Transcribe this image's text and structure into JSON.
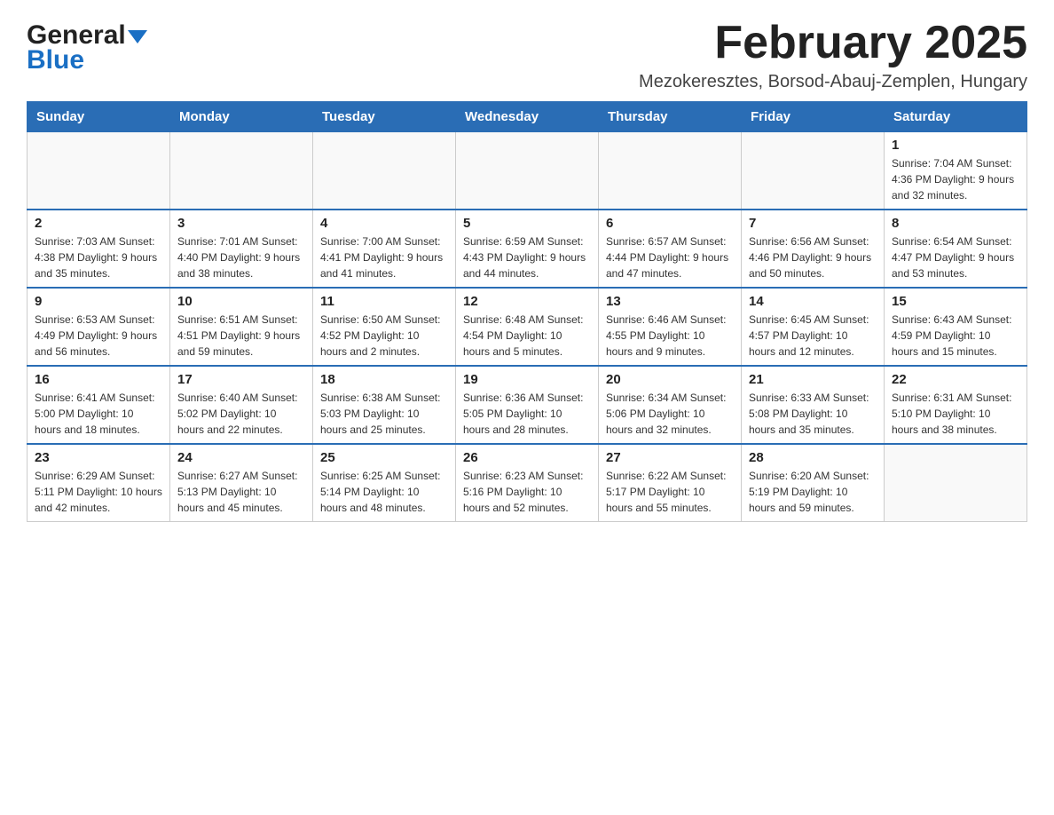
{
  "header": {
    "month_title": "February 2025",
    "location": "Mezokeresztes, Borsod-Abauj-Zemplen, Hungary",
    "logo_line1": "General",
    "logo_line2": "Blue"
  },
  "weekdays": [
    "Sunday",
    "Monday",
    "Tuesday",
    "Wednesday",
    "Thursday",
    "Friday",
    "Saturday"
  ],
  "weeks": [
    [
      {
        "day": "",
        "info": ""
      },
      {
        "day": "",
        "info": ""
      },
      {
        "day": "",
        "info": ""
      },
      {
        "day": "",
        "info": ""
      },
      {
        "day": "",
        "info": ""
      },
      {
        "day": "",
        "info": ""
      },
      {
        "day": "1",
        "info": "Sunrise: 7:04 AM\nSunset: 4:36 PM\nDaylight: 9 hours and 32 minutes."
      }
    ],
    [
      {
        "day": "2",
        "info": "Sunrise: 7:03 AM\nSunset: 4:38 PM\nDaylight: 9 hours and 35 minutes."
      },
      {
        "day": "3",
        "info": "Sunrise: 7:01 AM\nSunset: 4:40 PM\nDaylight: 9 hours and 38 minutes."
      },
      {
        "day": "4",
        "info": "Sunrise: 7:00 AM\nSunset: 4:41 PM\nDaylight: 9 hours and 41 minutes."
      },
      {
        "day": "5",
        "info": "Sunrise: 6:59 AM\nSunset: 4:43 PM\nDaylight: 9 hours and 44 minutes."
      },
      {
        "day": "6",
        "info": "Sunrise: 6:57 AM\nSunset: 4:44 PM\nDaylight: 9 hours and 47 minutes."
      },
      {
        "day": "7",
        "info": "Sunrise: 6:56 AM\nSunset: 4:46 PM\nDaylight: 9 hours and 50 minutes."
      },
      {
        "day": "8",
        "info": "Sunrise: 6:54 AM\nSunset: 4:47 PM\nDaylight: 9 hours and 53 minutes."
      }
    ],
    [
      {
        "day": "9",
        "info": "Sunrise: 6:53 AM\nSunset: 4:49 PM\nDaylight: 9 hours and 56 minutes."
      },
      {
        "day": "10",
        "info": "Sunrise: 6:51 AM\nSunset: 4:51 PM\nDaylight: 9 hours and 59 minutes."
      },
      {
        "day": "11",
        "info": "Sunrise: 6:50 AM\nSunset: 4:52 PM\nDaylight: 10 hours and 2 minutes."
      },
      {
        "day": "12",
        "info": "Sunrise: 6:48 AM\nSunset: 4:54 PM\nDaylight: 10 hours and 5 minutes."
      },
      {
        "day": "13",
        "info": "Sunrise: 6:46 AM\nSunset: 4:55 PM\nDaylight: 10 hours and 9 minutes."
      },
      {
        "day": "14",
        "info": "Sunrise: 6:45 AM\nSunset: 4:57 PM\nDaylight: 10 hours and 12 minutes."
      },
      {
        "day": "15",
        "info": "Sunrise: 6:43 AM\nSunset: 4:59 PM\nDaylight: 10 hours and 15 minutes."
      }
    ],
    [
      {
        "day": "16",
        "info": "Sunrise: 6:41 AM\nSunset: 5:00 PM\nDaylight: 10 hours and 18 minutes."
      },
      {
        "day": "17",
        "info": "Sunrise: 6:40 AM\nSunset: 5:02 PM\nDaylight: 10 hours and 22 minutes."
      },
      {
        "day": "18",
        "info": "Sunrise: 6:38 AM\nSunset: 5:03 PM\nDaylight: 10 hours and 25 minutes."
      },
      {
        "day": "19",
        "info": "Sunrise: 6:36 AM\nSunset: 5:05 PM\nDaylight: 10 hours and 28 minutes."
      },
      {
        "day": "20",
        "info": "Sunrise: 6:34 AM\nSunset: 5:06 PM\nDaylight: 10 hours and 32 minutes."
      },
      {
        "day": "21",
        "info": "Sunrise: 6:33 AM\nSunset: 5:08 PM\nDaylight: 10 hours and 35 minutes."
      },
      {
        "day": "22",
        "info": "Sunrise: 6:31 AM\nSunset: 5:10 PM\nDaylight: 10 hours and 38 minutes."
      }
    ],
    [
      {
        "day": "23",
        "info": "Sunrise: 6:29 AM\nSunset: 5:11 PM\nDaylight: 10 hours and 42 minutes."
      },
      {
        "day": "24",
        "info": "Sunrise: 6:27 AM\nSunset: 5:13 PM\nDaylight: 10 hours and 45 minutes."
      },
      {
        "day": "25",
        "info": "Sunrise: 6:25 AM\nSunset: 5:14 PM\nDaylight: 10 hours and 48 minutes."
      },
      {
        "day": "26",
        "info": "Sunrise: 6:23 AM\nSunset: 5:16 PM\nDaylight: 10 hours and 52 minutes."
      },
      {
        "day": "27",
        "info": "Sunrise: 6:22 AM\nSunset: 5:17 PM\nDaylight: 10 hours and 55 minutes."
      },
      {
        "day": "28",
        "info": "Sunrise: 6:20 AM\nSunset: 5:19 PM\nDaylight: 10 hours and 59 minutes."
      },
      {
        "day": "",
        "info": ""
      }
    ]
  ]
}
